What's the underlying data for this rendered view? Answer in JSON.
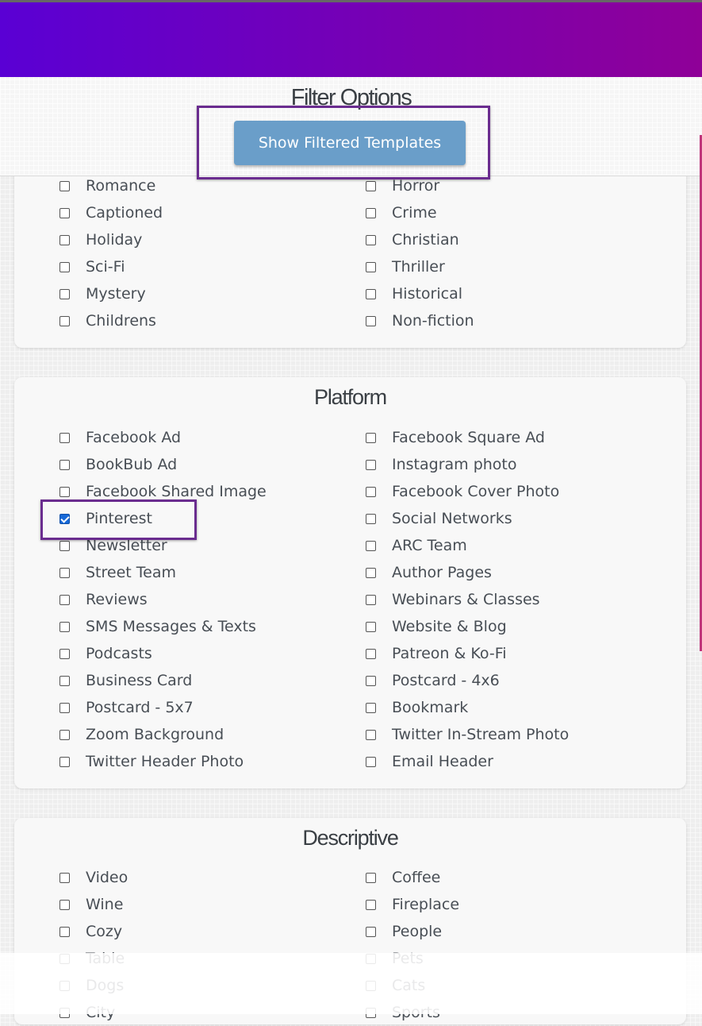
{
  "header": {
    "filter_title": "Filter Options",
    "show_button": "Show Filtered Templates"
  },
  "genre": {
    "left": [
      {
        "label": "Romance",
        "checked": false
      },
      {
        "label": "Captioned",
        "checked": false
      },
      {
        "label": "Holiday",
        "checked": false
      },
      {
        "label": "Sci-Fi",
        "checked": false
      },
      {
        "label": "Mystery",
        "checked": false
      },
      {
        "label": "Childrens",
        "checked": false
      }
    ],
    "right": [
      {
        "label": "Horror",
        "checked": false
      },
      {
        "label": "Crime",
        "checked": false
      },
      {
        "label": "Christian",
        "checked": false
      },
      {
        "label": "Thriller",
        "checked": false
      },
      {
        "label": "Historical",
        "checked": false
      },
      {
        "label": "Non-fiction",
        "checked": false
      }
    ]
  },
  "platform": {
    "title": "Platform",
    "left": [
      {
        "label": "Facebook Ad",
        "checked": false
      },
      {
        "label": "BookBub Ad",
        "checked": false
      },
      {
        "label": "Facebook Shared Image",
        "checked": false
      },
      {
        "label": "Pinterest",
        "checked": true
      },
      {
        "label": "Newsletter",
        "checked": false
      },
      {
        "label": "Street Team",
        "checked": false
      },
      {
        "label": "Reviews",
        "checked": false
      },
      {
        "label": "SMS Messages & Texts",
        "checked": false
      },
      {
        "label": "Podcasts",
        "checked": false
      },
      {
        "label": "Business Card",
        "checked": false
      },
      {
        "label": "Postcard - 5x7",
        "checked": false
      },
      {
        "label": "Zoom Background",
        "checked": false
      },
      {
        "label": "Twitter Header Photo",
        "checked": false
      }
    ],
    "right": [
      {
        "label": "Facebook Square Ad",
        "checked": false
      },
      {
        "label": "Instagram photo",
        "checked": false
      },
      {
        "label": "Facebook Cover Photo",
        "checked": false
      },
      {
        "label": "Social Networks",
        "checked": false
      },
      {
        "label": "ARC Team",
        "checked": false
      },
      {
        "label": "Author Pages",
        "checked": false
      },
      {
        "label": "Webinars & Classes",
        "checked": false
      },
      {
        "label": "Website & Blog",
        "checked": false
      },
      {
        "label": "Patreon & Ko-Fi",
        "checked": false
      },
      {
        "label": "Postcard - 4x6",
        "checked": false
      },
      {
        "label": "Bookmark",
        "checked": false
      },
      {
        "label": "Twitter In-Stream Photo",
        "checked": false
      },
      {
        "label": "Email Header",
        "checked": false
      }
    ]
  },
  "descriptive": {
    "title": "Descriptive",
    "left": [
      {
        "label": "Video",
        "checked": false
      },
      {
        "label": "Wine",
        "checked": false
      },
      {
        "label": "Cozy",
        "checked": false
      },
      {
        "label": "Table",
        "checked": false
      },
      {
        "label": "Dogs",
        "checked": false
      },
      {
        "label": "City",
        "checked": false
      }
    ],
    "right": [
      {
        "label": "Coffee",
        "checked": false
      },
      {
        "label": "Fireplace",
        "checked": false
      },
      {
        "label": "People",
        "checked": false
      },
      {
        "label": "Pets",
        "checked": false
      },
      {
        "label": "Cats",
        "checked": false
      },
      {
        "label": "Sports",
        "checked": false
      }
    ]
  },
  "colors": {
    "button": "#6a9ec9",
    "highlight": "#6a2c8f",
    "gradient_start": "#5a00d4",
    "gradient_end": "#8f0098"
  }
}
